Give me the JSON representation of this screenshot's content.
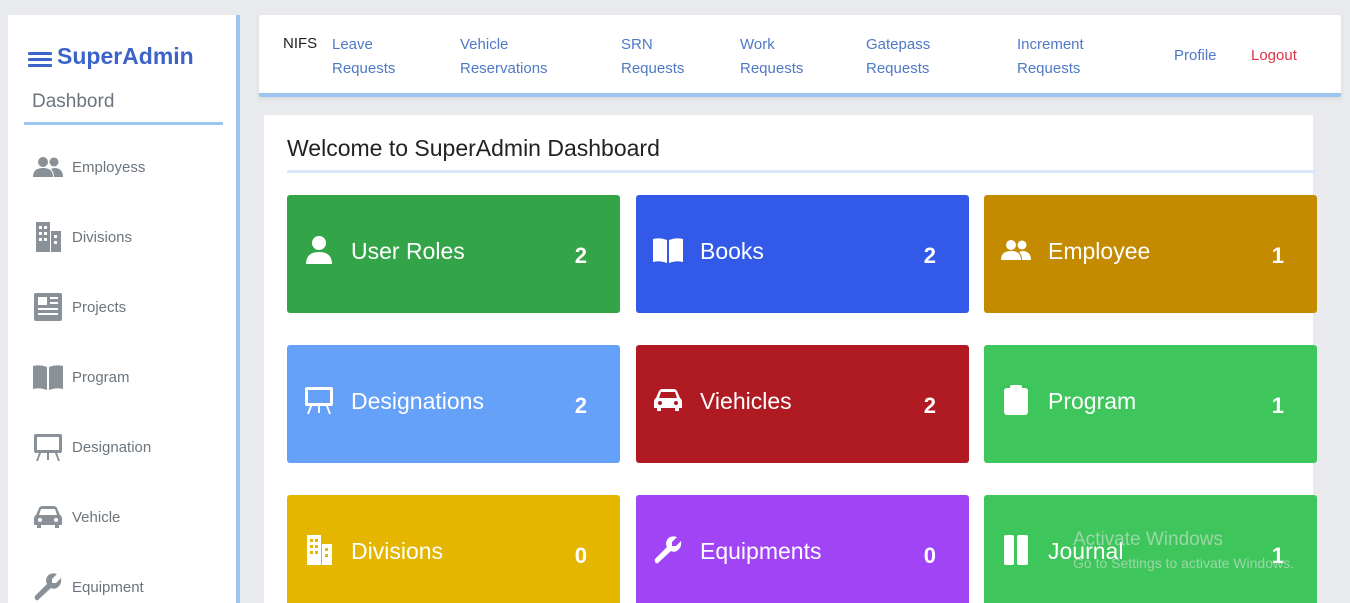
{
  "sidebar": {
    "brand": "SuperAdmin",
    "dashboard": "Dashbord",
    "items": [
      {
        "label": "Employess",
        "icon": "users-icon"
      },
      {
        "label": "Divisions",
        "icon": "building-icon"
      },
      {
        "label": "Projects",
        "icon": "newspaper-icon"
      },
      {
        "label": "Program",
        "icon": "book-icon"
      },
      {
        "label": "Designation",
        "icon": "easel-icon"
      },
      {
        "label": "Vehicle",
        "icon": "car-icon"
      },
      {
        "label": "Equipment",
        "icon": "wrench-icon"
      }
    ]
  },
  "topnav": {
    "brand": "NIFS",
    "links": [
      {
        "line1": "Leave",
        "line2": "Requests"
      },
      {
        "line1": "Vehicle",
        "line2": "Reservations"
      },
      {
        "line1": "SRN",
        "line2": "Requests"
      },
      {
        "line1": "Work",
        "line2": "Requests"
      },
      {
        "line1": "Gatepass",
        "line2": "Requests"
      },
      {
        "line1": "Increment",
        "line2": "Requests"
      }
    ],
    "profile": "Profile",
    "logout": "Logout"
  },
  "main": {
    "welcome": "Welcome to SuperAdmin Dashboard",
    "tiles": [
      {
        "label": "User Roles",
        "count": "2",
        "color": "#33a447",
        "icon": "user-icon"
      },
      {
        "label": "Books",
        "count": "2",
        "color": "#3259e8",
        "icon": "book-open-icon"
      },
      {
        "label": "Employee",
        "count": "1",
        "color": "#c48a00",
        "icon": "users-icon"
      },
      {
        "label": "Designations",
        "count": "2",
        "color": "#65a0f9",
        "icon": "easel-icon"
      },
      {
        "label": "Viehicles",
        "count": "2",
        "color": "#b01a22",
        "icon": "car-icon"
      },
      {
        "label": "Program",
        "count": "1",
        "color": "#3ec55b",
        "icon": "clipboard-icon"
      },
      {
        "label": "Divisions",
        "count": "0",
        "color": "#e5b600",
        "icon": "building-icon"
      },
      {
        "label": "Equipments",
        "count": "0",
        "color": "#a044f5",
        "icon": "wrench-icon"
      },
      {
        "label": "Journal",
        "count": "1",
        "color": "#3ec55b",
        "icon": "journal-icon"
      }
    ]
  },
  "watermark": {
    "line1": "Activate Windows",
    "line2": "Go to Settings to activate Windows."
  }
}
